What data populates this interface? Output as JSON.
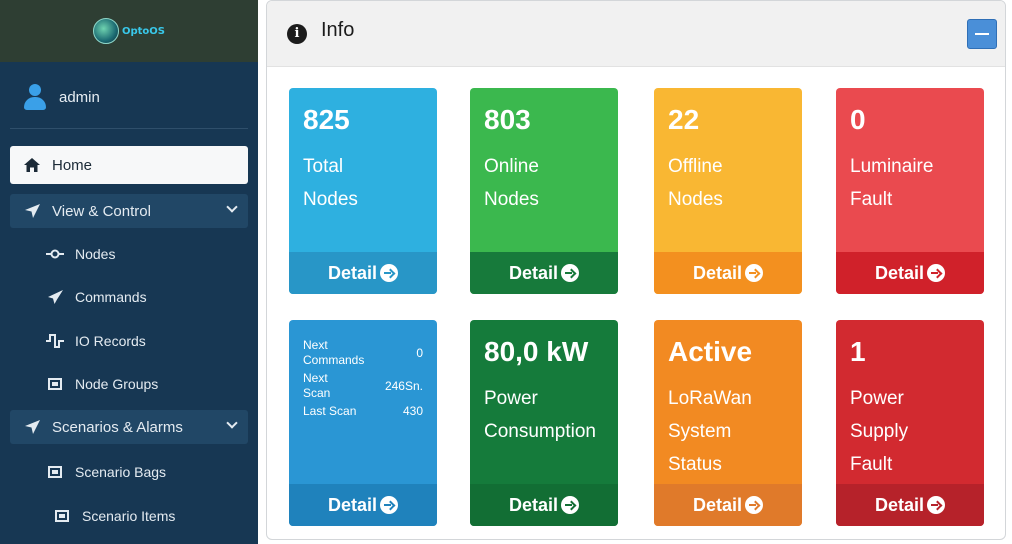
{
  "brand": {
    "logo_text": "OptoOS"
  },
  "user": {
    "name": "admin"
  },
  "sidebar": {
    "items": [
      {
        "label": "Home",
        "icon": "home-icon"
      },
      {
        "label": "View & Control",
        "icon": "location-arrow-icon"
      },
      {
        "label": "Nodes",
        "icon": "node-icon"
      },
      {
        "label": "Commands",
        "icon": "paper-plane-icon"
      },
      {
        "label": "IO Records",
        "icon": "signal-pulse-icon"
      },
      {
        "label": "Node Groups",
        "icon": "group-box-icon"
      },
      {
        "label": "Scenarios & Alarms",
        "icon": "location-arrow-icon"
      },
      {
        "label": "Scenario Bags",
        "icon": "group-box-icon"
      },
      {
        "label": "Scenario Items",
        "icon": "group-box-icon"
      }
    ]
  },
  "panel": {
    "title": "Info"
  },
  "cards": [
    {
      "value": "825",
      "label": "Total\nNodes",
      "detail": "Detail",
      "color": "#2eb0e0",
      "footer": "#2896c7"
    },
    {
      "value": "803",
      "label": "Online\nNodes",
      "detail": "Detail",
      "color": "#3bb84e",
      "footer": "#177a3b"
    },
    {
      "value": "22",
      "label": "Offline\nNodes",
      "detail": "Detail",
      "color": "#f9b733",
      "footer": "#f3901f"
    },
    {
      "value": "0",
      "label": "Luminaire\nFault",
      "detail": "Detail",
      "color": "#ea4a4f",
      "footer": "#d0212a"
    },
    {
      "detail": "Detail",
      "color": "#2a96d4",
      "footer": "#1f82bc",
      "stats": [
        {
          "label": "Next\nCommands",
          "value": "0"
        },
        {
          "label": "Next\nScan",
          "value": "246Sn."
        },
        {
          "label": "Last Scan",
          "value": "430"
        }
      ]
    },
    {
      "value": "80,0 kW",
      "label": "Power\nConsumption",
      "detail": "Detail",
      "color": "#157b3b",
      "footer": "#126e34"
    },
    {
      "value": "Active",
      "label": "LoRaWan\nSystem\nStatus",
      "detail": "Detail",
      "color": "#f28a22",
      "footer": "#e07a2a"
    },
    {
      "value": "1",
      "label": "Power\nSupply\nFault",
      "detail": "Detail",
      "color": "#d22a30",
      "footer": "#b6222a"
    }
  ]
}
